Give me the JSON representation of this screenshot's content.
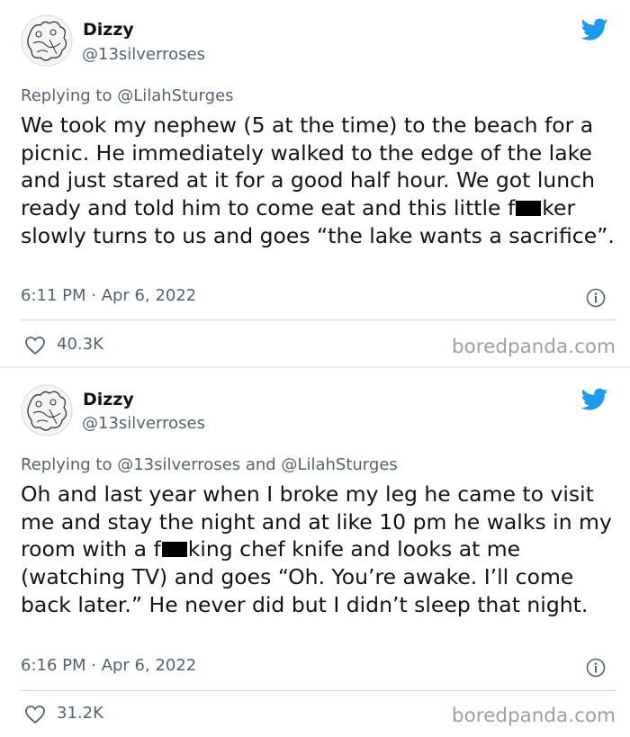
{
  "colors": {
    "text": "#0f1419",
    "secondary": "#536471",
    "twitter_blue": "#1d9bf0",
    "watermark": "#9aa0a6",
    "divider": "#cfd9de"
  },
  "tweets": [
    {
      "author_name": "Dizzy",
      "author_handle": "@13silverroses",
      "replying_to": "Replying to @LilahSturges",
      "body_before": "We took my nephew (5 at the time) to the beach for a picnic. He immediately walked to the edge of the lake and just stared at it for a good half hour. We got lunch ready and told him to come eat and this little f",
      "body_after": "ker slowly turns to us and goes “the lake wants a sacrifice”.",
      "timestamp": "6:11 PM · Apr 6, 2022",
      "likes": "40.3K",
      "watermark": "boredpanda.com",
      "icons": [
        "avatar-icon",
        "twitter-bird-icon",
        "info-icon",
        "heart-icon"
      ]
    },
    {
      "author_name": "Dizzy",
      "author_handle": "@13silverroses",
      "replying_to": "Replying to @13silverroses and @LilahSturges",
      "body_before": "Oh and last year when I broke my leg he came to visit me and stay the night and at like 10 pm he walks in my room with a f",
      "body_after": "king chef knife and looks at me (watching TV) and goes “Oh. You’re awake. I’ll come back later.” He never did but I didn’t sleep that night.",
      "timestamp": "6:16 PM · Apr 6, 2022",
      "likes": "31.2K",
      "watermark": "boredpanda.com",
      "icons": [
        "avatar-icon",
        "twitter-bird-icon",
        "info-icon",
        "heart-icon"
      ]
    }
  ]
}
